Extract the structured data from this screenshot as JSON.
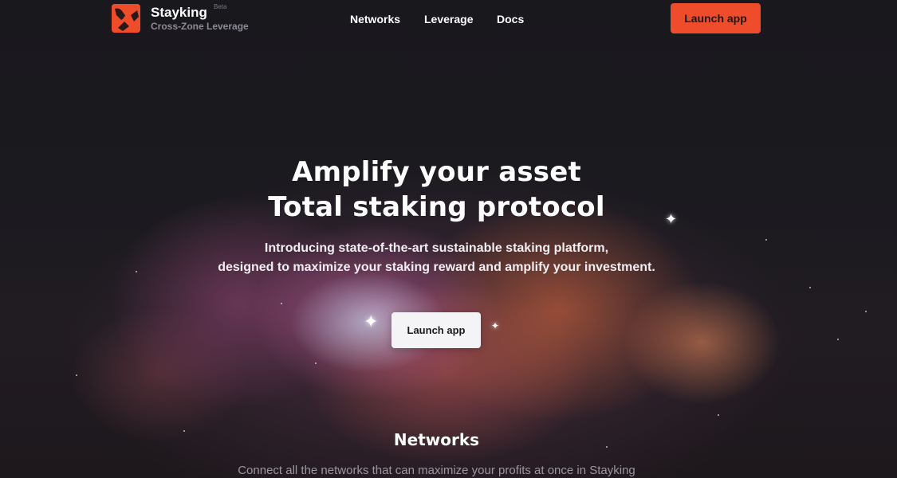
{
  "brand": {
    "name": "Stayking",
    "badge": "Beta",
    "tagline": "Cross-Zone Leverage",
    "accent_color": "#ef4c2b"
  },
  "nav": {
    "links": [
      "Networks",
      "Leverage",
      "Docs"
    ],
    "cta_label": "Launch app"
  },
  "hero": {
    "title_line1": "Amplify your asset",
    "title_line2": "Total staking protocol",
    "subtitle_line1": "Introducing state-of-the-art sustainable staking platform,",
    "subtitle_line2": "designed to maximize your staking reward and amplify your investment.",
    "cta_label": "Launch app"
  },
  "networks_section": {
    "title": "Networks",
    "subtitle": "Connect all the networks that can maximize your profits at once in Stayking"
  }
}
